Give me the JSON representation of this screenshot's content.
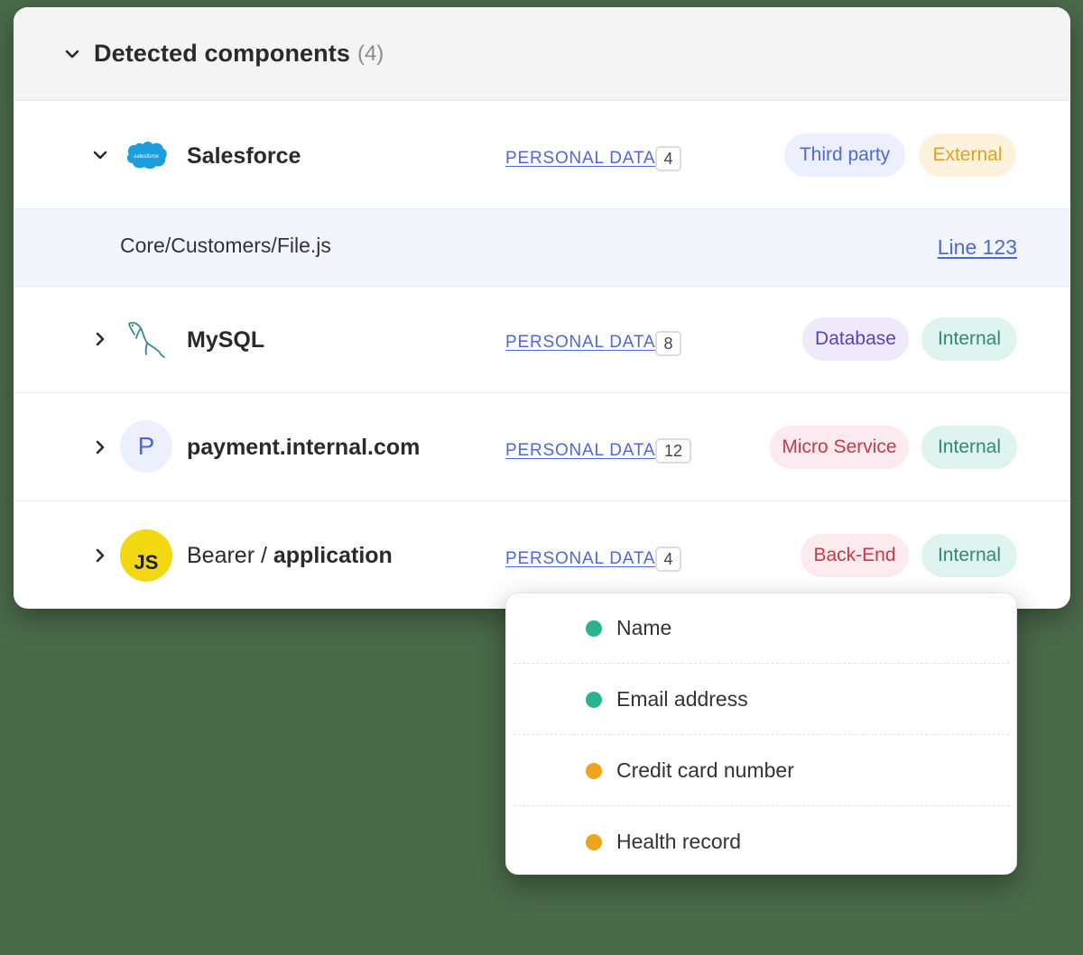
{
  "header": {
    "title": "Detected components",
    "count": "(4)"
  },
  "colors": {
    "dot_green": "#28b48e",
    "dot_orange": "#f0a41b",
    "link": "#4f67d8"
  },
  "rows": [
    {
      "name": "Salesforce",
      "logo": "salesforce-logo",
      "logo_text": "salesforce",
      "expanded": true,
      "pd_label": "PERSONAL DATA",
      "count": "4",
      "tags": [
        {
          "label": "Third party",
          "bg": "#eceffd",
          "fg": "#4f67d8"
        },
        {
          "label": "External",
          "bg": "#fdf2dc",
          "fg": "#e2a21d"
        }
      ]
    },
    {
      "name": "MySQL",
      "logo": "mysql-dolphin-logo",
      "expanded": false,
      "pd_label": "PERSONAL DATA",
      "count": "8",
      "tags": [
        {
          "label": "Database",
          "bg": "#eeeafb",
          "fg": "#5a3fc0"
        },
        {
          "label": "Internal",
          "bg": "#dff4ee",
          "fg": "#2c8c6e"
        }
      ]
    },
    {
      "name": "payment.internal.com",
      "logo": "letter-p-avatar",
      "logo_text": "P",
      "expanded": false,
      "pd_label": "PERSONAL DATA",
      "count": "12",
      "tags": [
        {
          "label": "Micro Service",
          "bg": "#fcebee",
          "fg": "#c43a4b"
        },
        {
          "label": "Internal",
          "bg": "#dff4ee",
          "fg": "#2c8c6e"
        }
      ]
    },
    {
      "name_prefix": "Bearer / ",
      "name": "application",
      "logo": "javascript-logo",
      "logo_text": "JS",
      "expanded": false,
      "pd_label": "PERSONAL DATA",
      "count": "4",
      "tags": [
        {
          "label": "Back-End",
          "bg": "#fcebee",
          "fg": "#c43a4b"
        },
        {
          "label": "Internal",
          "bg": "#dff4ee",
          "fg": "#2c8c6e"
        }
      ]
    }
  ],
  "file_row": {
    "path": "Core/Customers/File.js",
    "line": "Line 123"
  },
  "popup_items": [
    {
      "label": "Name",
      "dot": "green"
    },
    {
      "label": "Email address",
      "dot": "green"
    },
    {
      "label": "Credit card number",
      "dot": "orange"
    },
    {
      "label": "Health record",
      "dot": "orange"
    }
  ]
}
